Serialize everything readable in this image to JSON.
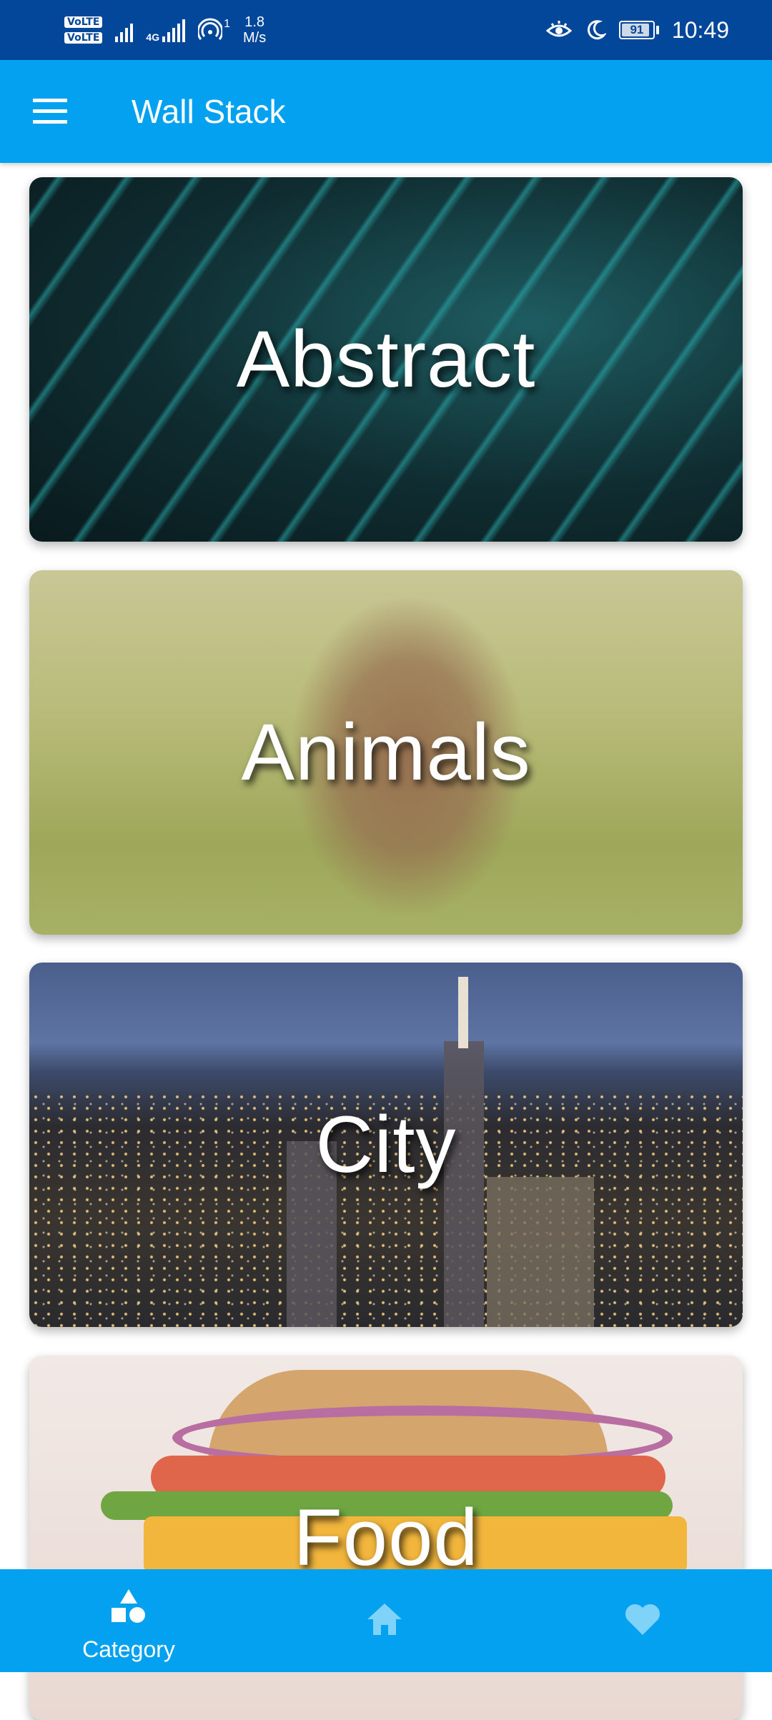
{
  "status_bar": {
    "sim1": "VoLTE",
    "sim2": "VoLTE",
    "network": "4G",
    "hotspot_count": "1",
    "net_speed_value": "1.8",
    "net_speed_unit": "M/s",
    "battery": "91",
    "time": "10:49",
    "icons": [
      "eye-comfort-icon",
      "moon-icon",
      "battery-icon"
    ]
  },
  "app_bar": {
    "title": "Wall Stack",
    "menu_icon": "menu-icon"
  },
  "categories": [
    {
      "label": "Abstract"
    },
    {
      "label": "Animals"
    },
    {
      "label": "City"
    },
    {
      "label": "Food"
    }
  ],
  "bottom_nav": {
    "items": [
      {
        "label": "Category",
        "icon": "category-icon",
        "active": true
      },
      {
        "label": "",
        "icon": "home-icon",
        "active": false
      },
      {
        "label": "",
        "icon": "heart-icon",
        "active": false
      }
    ]
  },
  "colors": {
    "status_bar": "#03479b",
    "app_bar": "#03a1ef",
    "bottom_nav": "#03a1ef",
    "nav_inactive_icon": "#7fd2f8"
  }
}
